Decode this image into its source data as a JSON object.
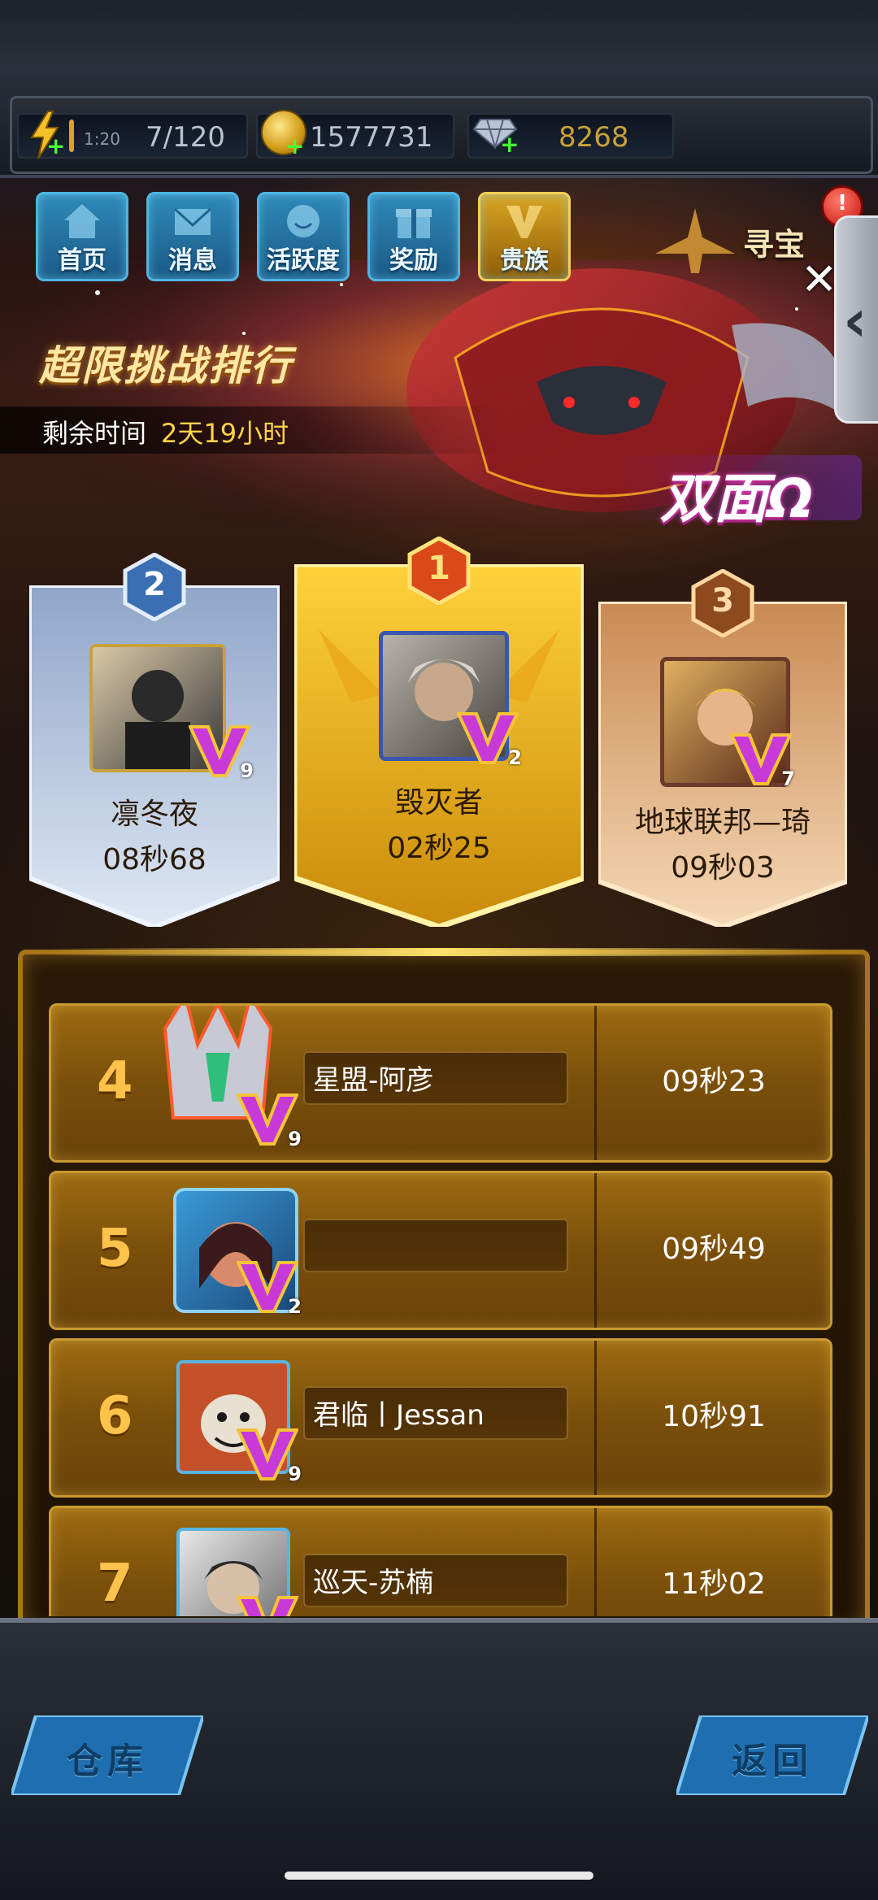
{
  "resources": {
    "energy_timer": "1:20",
    "energy": "7/120",
    "coins": "1577731",
    "gems": "8268"
  },
  "nav": {
    "items": [
      "首页",
      "消息",
      "活跃度",
      "奖励",
      "贵族"
    ],
    "treasure": "寻宝",
    "badge": "!"
  },
  "event": {
    "title": "超限挑战排行",
    "time_label": "剩余时间",
    "time_value": "2天19小时",
    "boss": "双面Ω"
  },
  "podium": [
    {
      "rank": "2",
      "name": "凛冬夜",
      "time": "08秒68",
      "vip": "9"
    },
    {
      "rank": "1",
      "name": "毁灭者",
      "time": "02秒25",
      "vip": "2"
    },
    {
      "rank": "3",
      "name": "地球联邦—琦",
      "time": "09秒03",
      "vip": "7"
    }
  ],
  "list": [
    {
      "rank": "4",
      "name": "星盟-阿彦",
      "time": "09秒23",
      "vip": "9"
    },
    {
      "rank": "5",
      "name": "",
      "time": "09秒49",
      "vip": "2"
    },
    {
      "rank": "6",
      "name": "君临丨Jessan",
      "time": "10秒91",
      "vip": "9"
    },
    {
      "rank": "7",
      "name": "巡天-苏楠",
      "time": "11秒02",
      "vip": ""
    }
  ],
  "bottom": {
    "warehouse": "仓库",
    "back": "返回"
  },
  "colors": {
    "gold": "#ffc24a",
    "time_highlight": "#ffd34a",
    "nav_blue": "#1b5a87"
  }
}
